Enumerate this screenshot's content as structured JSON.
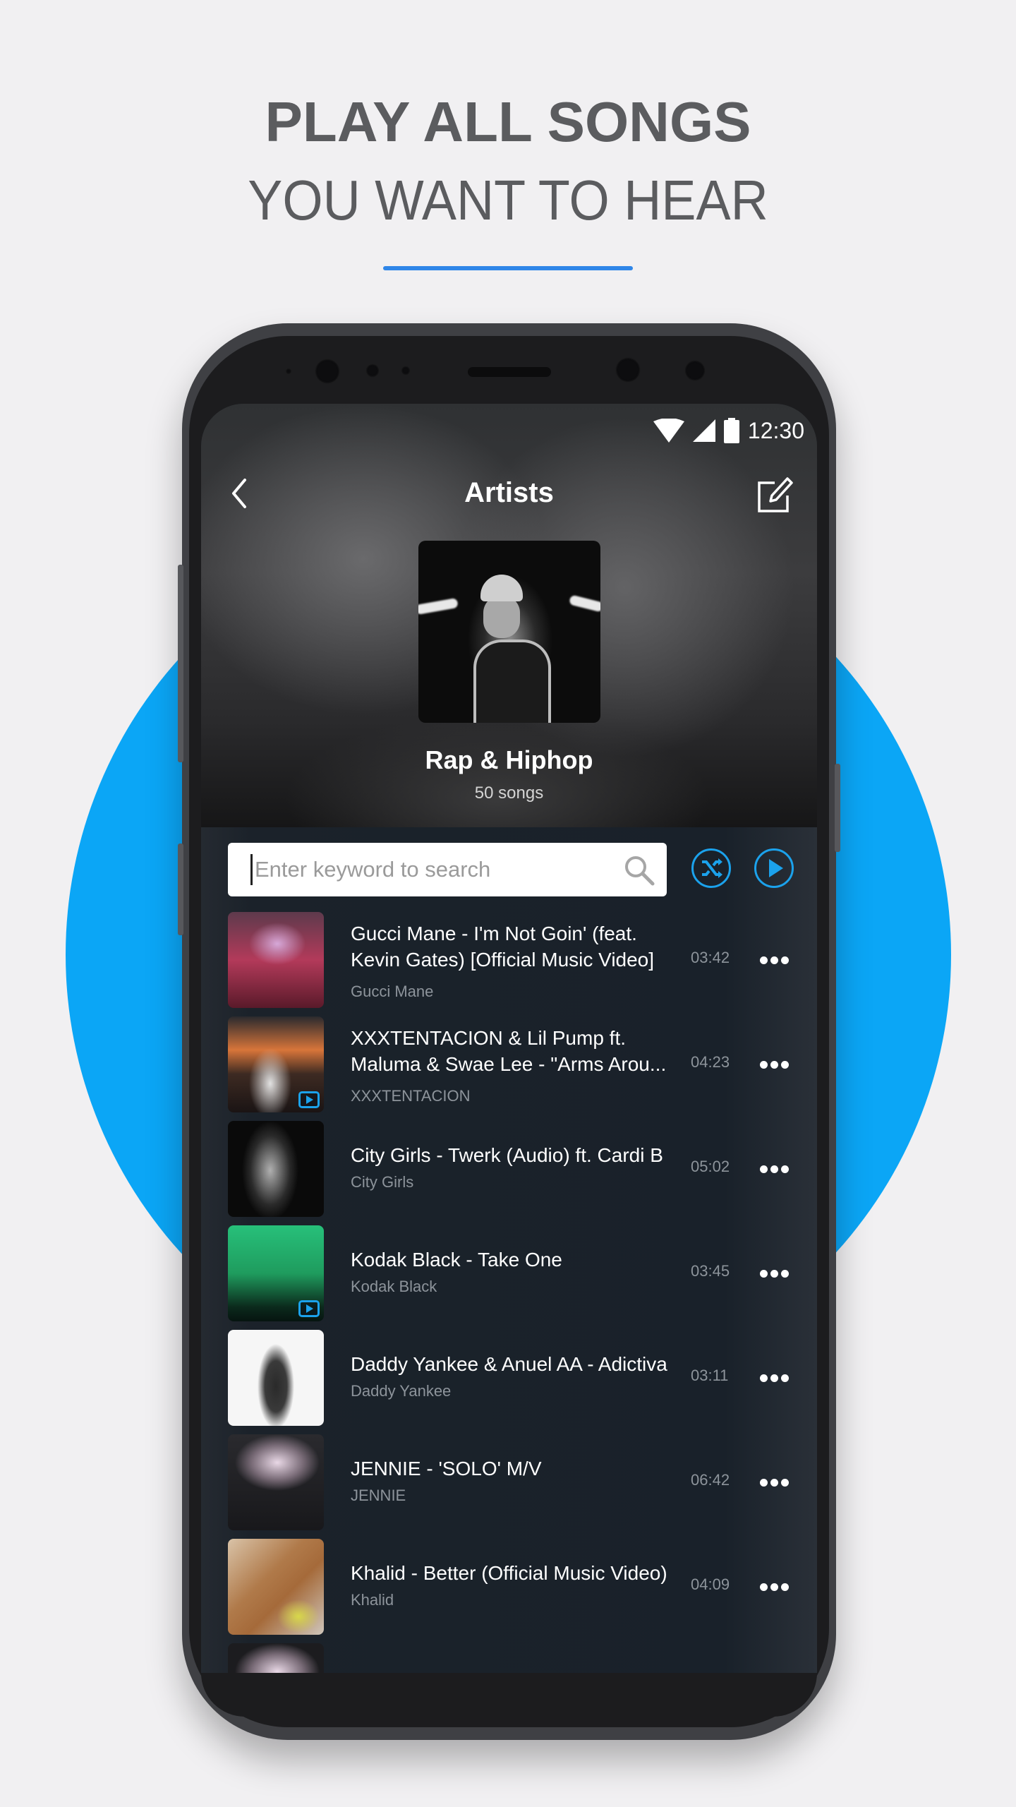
{
  "promo": {
    "headline_bold": "PLAY ALL SONGS",
    "headline_light": "YOU WANT TO HEAR",
    "accent_color": "#2f86e8",
    "circle_color": "#0ba6f6"
  },
  "status_bar": {
    "time": "12:30",
    "icons": [
      "wifi-icon",
      "signal-icon",
      "battery-icon"
    ]
  },
  "app_bar": {
    "title": "Artists",
    "back_icon": "chevron-left-icon",
    "edit_icon": "edit-icon"
  },
  "playlist": {
    "name": "Rap & Hiphop",
    "song_count": "50 songs"
  },
  "search": {
    "value": "",
    "placeholder": "Enter keyword to search",
    "icon": "search-icon"
  },
  "actions": {
    "shuffle_icon": "shuffle-icon",
    "play_all_icon": "play-icon",
    "accent_color": "#1ba2ec"
  },
  "songs": [
    {
      "title": "Gucci Mane - I'm Not Goin' (feat. Kevin Gates) [Official Music Video]",
      "artist": "Gucci Mane",
      "duration": "03:42",
      "video": false
    },
    {
      "title": "XXXTENTACION & Lil Pump ft. Maluma & Swae Lee - \"Arms Arou...",
      "artist": "XXXTENTACION",
      "duration": "04:23",
      "video": true
    },
    {
      "title": "City Girls - Twerk (Audio) ft. Cardi B",
      "artist": "City Girls",
      "duration": "05:02",
      "video": false
    },
    {
      "title": "Kodak Black - Take One",
      "artist": "Kodak Black",
      "duration": "03:45",
      "video": true
    },
    {
      "title": "Daddy Yankee & Anuel AA - Adictiva",
      "artist": "Daddy Yankee",
      "duration": "03:11",
      "video": false
    },
    {
      "title": "JENNIE - 'SOLO' M/V",
      "artist": "JENNIE",
      "duration": "06:42",
      "video": false
    },
    {
      "title": "Khalid - Better (Official Music Video)",
      "artist": "Khalid",
      "duration": "04:09",
      "video": false
    }
  ]
}
